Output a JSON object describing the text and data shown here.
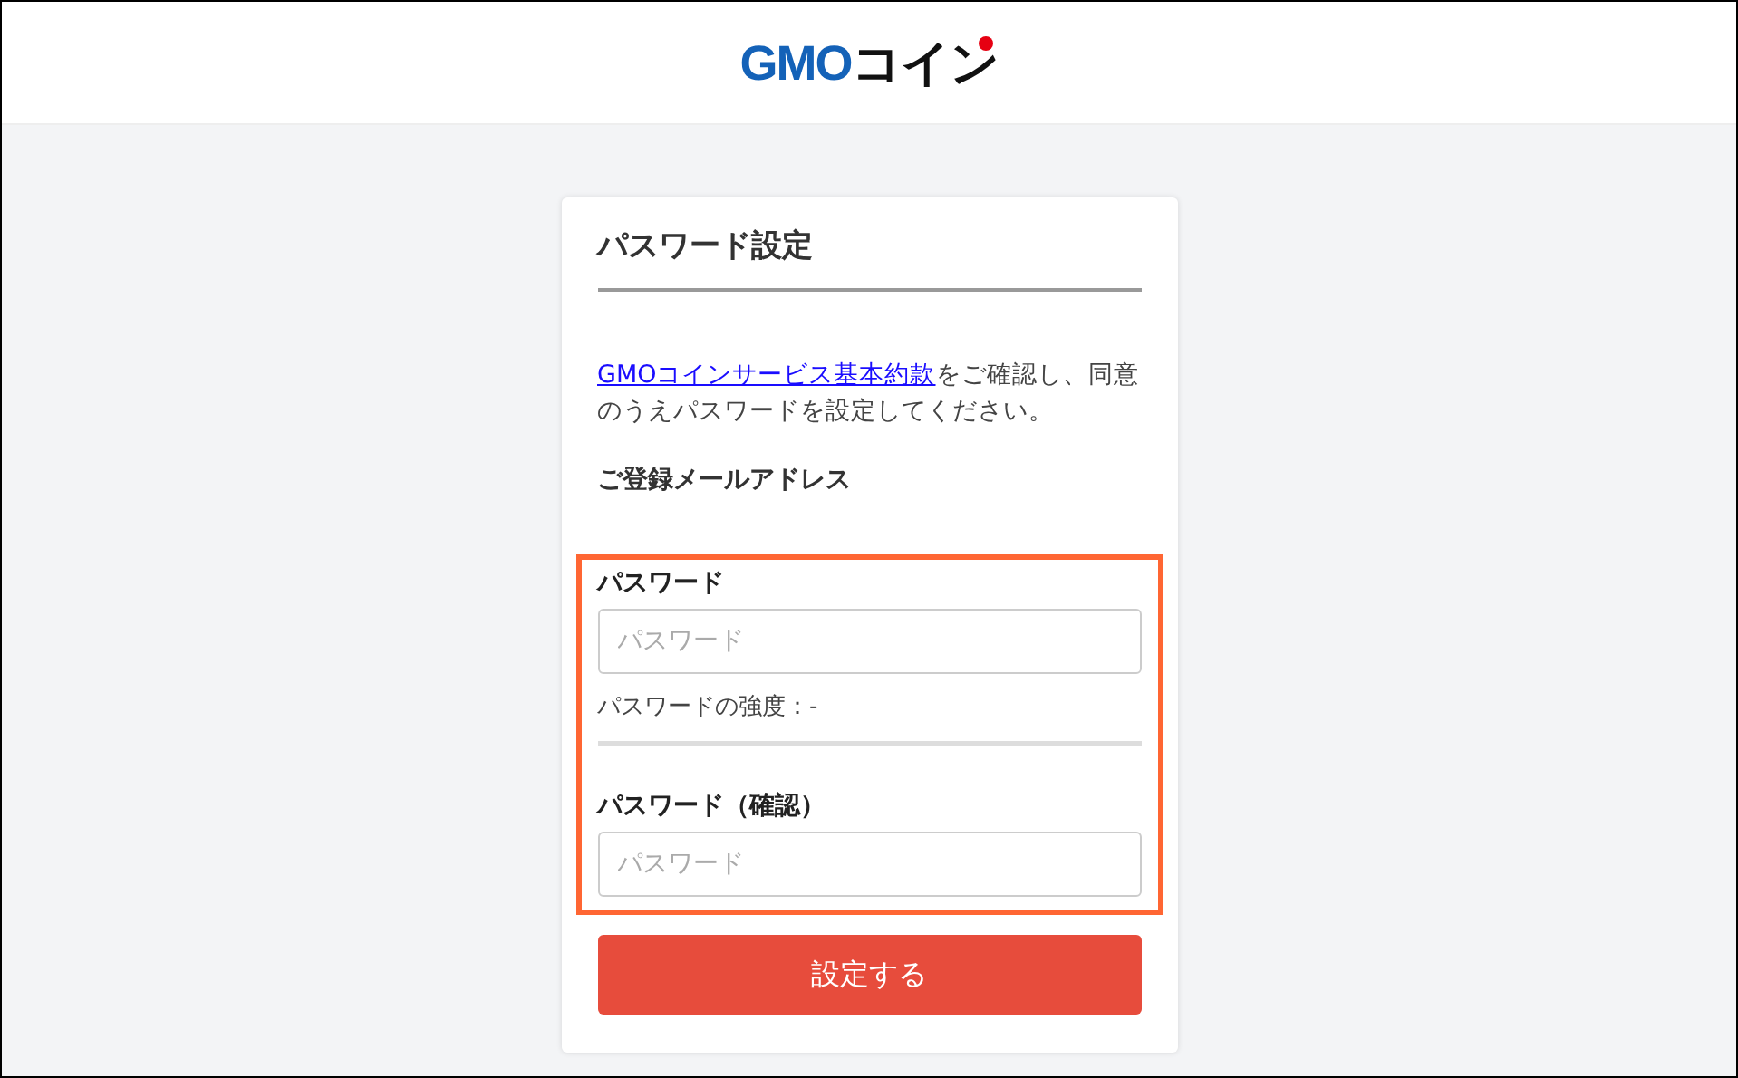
{
  "header": {
    "logo": {
      "brand": "GMO",
      "suffix": "コイン"
    }
  },
  "card": {
    "title": "パスワード設定",
    "notice": {
      "link": "GMOコインサービス基本約款",
      "text": "をご確認し、同意のうえパスワードを設定してください。"
    },
    "email_label": "ご登録メールアドレス",
    "highlighted": true,
    "password": {
      "label": "パスワード",
      "placeholder": "パスワード"
    },
    "strength": {
      "text": "パスワードの強度：-",
      "level": 0
    },
    "confirm": {
      "label": "パスワード（確認）",
      "placeholder": "パスワード"
    },
    "submit": "設定する"
  }
}
